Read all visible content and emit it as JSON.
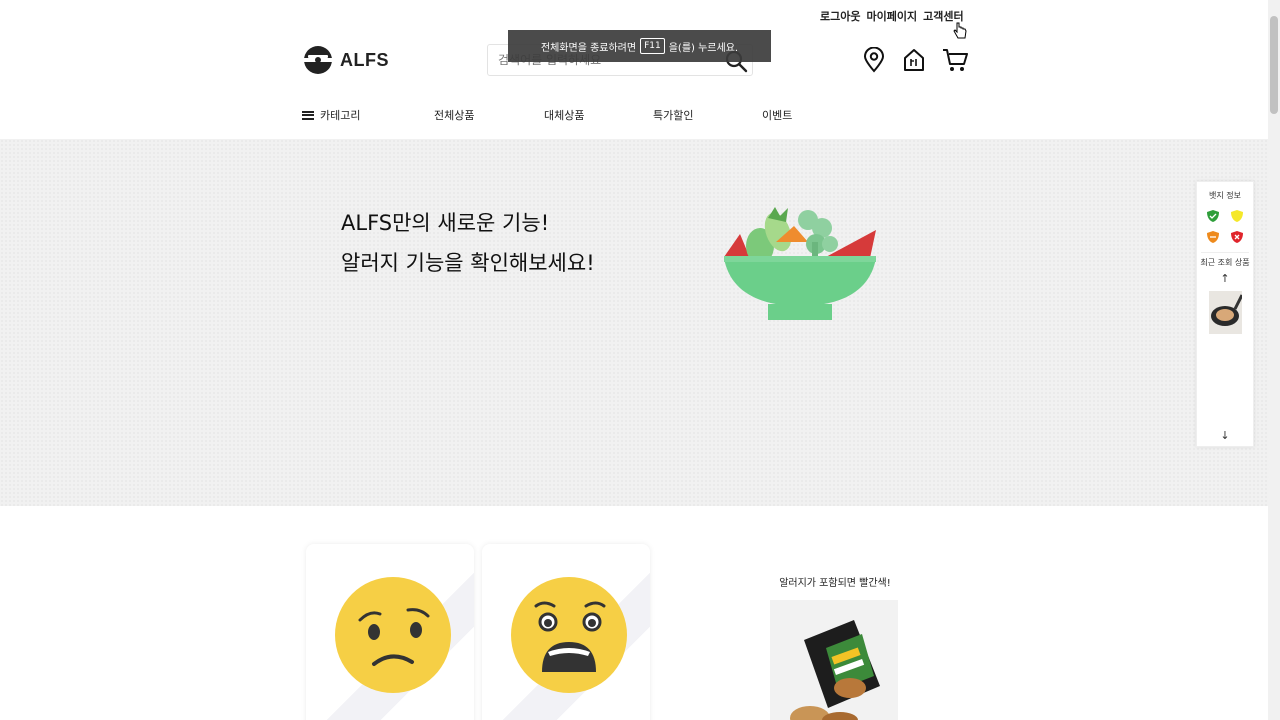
{
  "util": {
    "logout": "로그아웃",
    "mypage": "마이페이지",
    "support": "고객센터"
  },
  "logo": {
    "text": "ALFS"
  },
  "search": {
    "placeholder": "검색어를 입력하세요"
  },
  "fullscreen_toast": {
    "before": "전체화면을 종료하려면",
    "key": "F11",
    "after": "을(를) 누르세요."
  },
  "nav": {
    "category": "카테고리",
    "all": "전체상품",
    "alternative": "대체상품",
    "sale": "특가할인",
    "event": "이벤트"
  },
  "hero": {
    "line1": "ALFS만의 새로운 기능!",
    "line2": "알러지 기능을 확인해보세요!"
  },
  "side": {
    "badge_title": "뱃지 정보",
    "recent_title": "최근 조회 상품",
    "up": "↑",
    "down": "↓"
  },
  "lower": {
    "caption": "알러지가 포함되면 빨간색!"
  },
  "colors": {
    "badge_green": "#2e9e3a",
    "badge_yellow": "#f5e829",
    "badge_orange": "#ee8a1c",
    "badge_red": "#e0242b",
    "bowl": "#6bcf8a"
  },
  "icons": [
    "location-icon",
    "store-icon",
    "cart-icon",
    "search-icon",
    "hamburger-icon"
  ]
}
